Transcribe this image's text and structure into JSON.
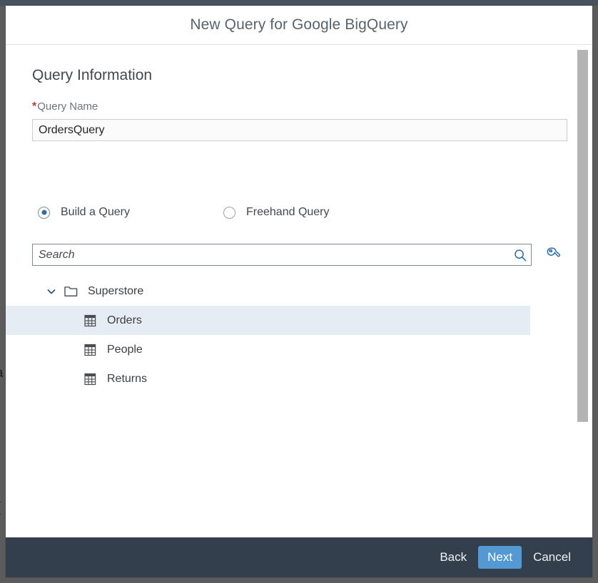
{
  "dialog": {
    "title": "New Query for Google BigQuery"
  },
  "section": {
    "heading": "Query Information"
  },
  "query_name": {
    "required_marker": "*",
    "label": "Query Name",
    "value": "OrdersQuery"
  },
  "mode_options": [
    {
      "label": "Build a Query",
      "selected": true
    },
    {
      "label": "Freehand Query",
      "selected": false
    }
  ],
  "search": {
    "placeholder": "Search",
    "value": "",
    "icon": "search-icon",
    "tool_icon": "wrench-icon"
  },
  "tree": {
    "root": {
      "label": "Superstore",
      "icon": "folder-icon",
      "expander": "chevron-down-icon",
      "expanded": true
    },
    "children": [
      {
        "label": "Orders",
        "icon": "table-icon",
        "selected": true
      },
      {
        "label": "People",
        "icon": "table-icon",
        "selected": false
      },
      {
        "label": "Returns",
        "icon": "table-icon",
        "selected": false
      }
    ]
  },
  "footer": {
    "back_label": "Back",
    "next_label": "Next",
    "cancel_label": "Cancel"
  },
  "colors": {
    "chrome": "#333f4d",
    "primary_button": "#539ad4",
    "selection": "#e6ecf4",
    "required": "#c0392b",
    "icon_blue": "#2f6da8"
  },
  "background": {
    "glyph_left_1": "a",
    "glyph_left_2": "(",
    "backdrop_color": "#5c5c5c"
  }
}
